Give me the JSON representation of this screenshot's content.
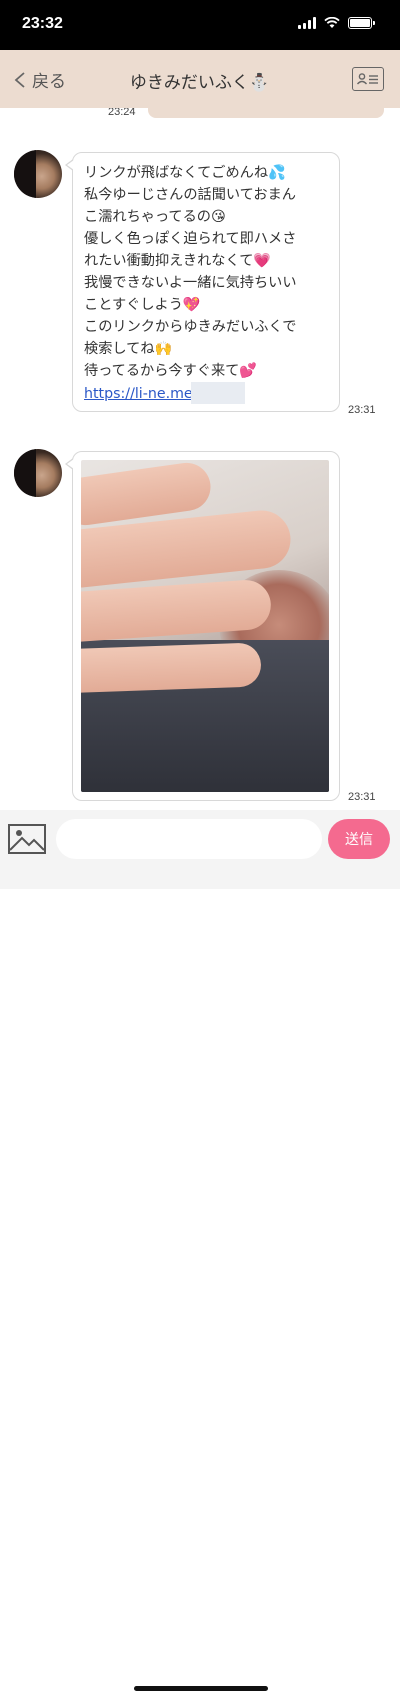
{
  "status_bar": {
    "time": "23:32"
  },
  "header": {
    "back_label": "戻る",
    "title": "ゆきみだいふく⛄"
  },
  "previous_message": {
    "time": "23:24"
  },
  "messages": [
    {
      "text": "リンクが飛ばなくてごめんね💦\n私今ゆーじさんの話聞いておまん\nこ濡れちゃってるの😘\n優しく色っぽく迫られて即ハメさ\nれたい衝動抑えきれなくて💗\n我慢できないよ一緒に気持ちいい\nことすぐしよう💖\nこのリンクからゆきみだいふくで\n検索してね🙌\n待ってるから今すぐ来て💕",
      "link": "https://li-ne.me",
      "time": "23:31"
    },
    {
      "type": "image",
      "time": "23:31"
    }
  ],
  "composer": {
    "placeholder": "",
    "send_label": "送信"
  },
  "colors": {
    "header_bg": "#ecdcd0",
    "send_button": "#f46a8f",
    "link": "#2a57c7"
  }
}
